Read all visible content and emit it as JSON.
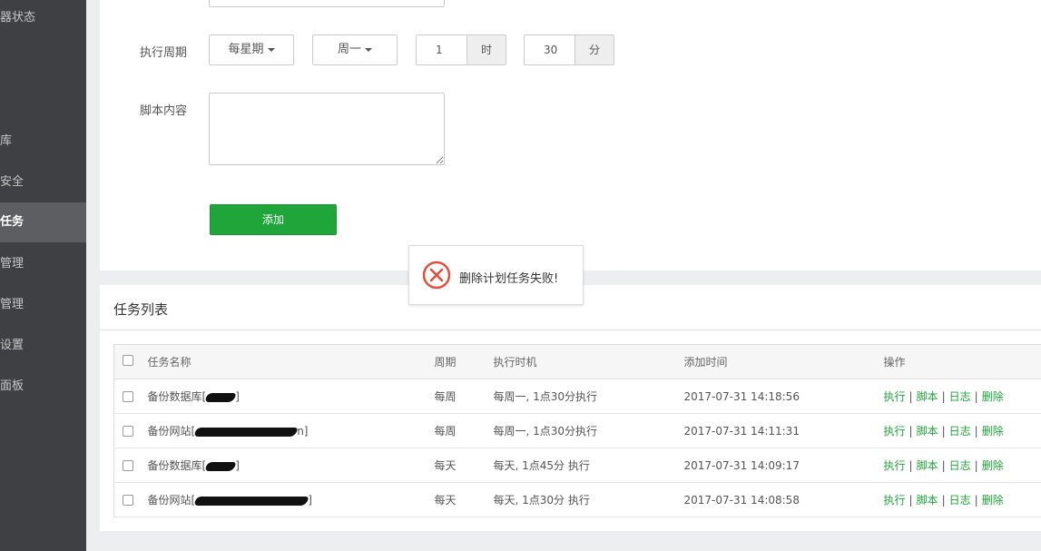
{
  "sidebar": {
    "items": [
      {
        "label": "器状态",
        "active": false
      },
      {
        "label": "库",
        "active": false
      },
      {
        "label": "安全",
        "active": false
      },
      {
        "label": "任务",
        "active": true
      },
      {
        "label": "管理",
        "active": false
      },
      {
        "label": "管理",
        "active": false
      },
      {
        "label": "设置",
        "active": false
      },
      {
        "label": "面板",
        "active": false
      }
    ]
  },
  "form": {
    "cycle_label": "执行周期",
    "period_dropdown": "每星期",
    "weekday_dropdown": "周一",
    "hour_value": "1",
    "hour_unit": "时",
    "minute_value": "30",
    "minute_unit": "分",
    "script_label": "脚本内容",
    "script_value": "",
    "add_button": "添加"
  },
  "toast": {
    "message": "删除计划任务失败!",
    "icon": "error-circle-icon",
    "color": "#e74c3c"
  },
  "task_list": {
    "title": "任务列表",
    "columns": [
      "任务名称",
      "周期",
      "执行时机",
      "添加时间",
      "操作"
    ],
    "rows": [
      {
        "name": "备份数据库[",
        "name_suffix": "]",
        "period": "每周",
        "timing": "每周一, 1点30分执行",
        "added": "2017-07-31 14:18:56"
      },
      {
        "name": "备份网站[",
        "name_suffix": "n]",
        "period": "每周",
        "timing": "每周一, 1点30分执行",
        "added": "2017-07-31 14:11:31"
      },
      {
        "name": "备份数据库[",
        "name_suffix": "]",
        "period": "每天",
        "timing": "每天, 1点45分 执行",
        "added": "2017-07-31 14:09:17"
      },
      {
        "name": "备份网站[",
        "name_suffix": "]",
        "period": "每天",
        "timing": "每天, 1点30分 执行",
        "added": "2017-07-31 14:08:58"
      }
    ],
    "actions": [
      "执行",
      "脚本",
      "日志",
      "删除"
    ],
    "action_color": "#20a53a"
  },
  "colors": {
    "accent": "#20a53a",
    "sidebar_bg": "#3f4043",
    "sidebar_active": "#5d5e61",
    "page_bg": "#eceeef"
  }
}
